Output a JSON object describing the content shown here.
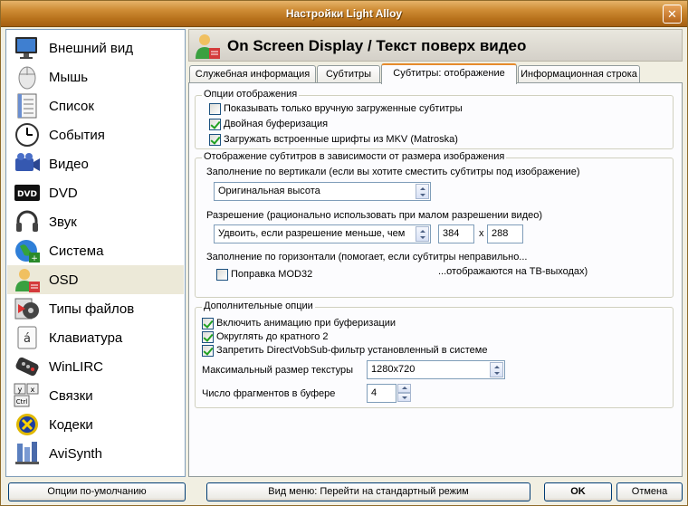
{
  "window": {
    "title": "Настройки Light Alloy",
    "close_glyph": "✕"
  },
  "sidebar": {
    "items": [
      {
        "label": "Внешний вид",
        "icon": "monitor-icon"
      },
      {
        "label": "Мышь",
        "icon": "mouse-icon"
      },
      {
        "label": "Список",
        "icon": "list-icon"
      },
      {
        "label": "События",
        "icon": "clock-icon"
      },
      {
        "label": "Видео",
        "icon": "video-camera-icon"
      },
      {
        "label": "DVD",
        "icon": "dvd-icon"
      },
      {
        "label": "Звук",
        "icon": "headphones-icon"
      },
      {
        "label": "Система",
        "icon": "globe-icon"
      },
      {
        "label": "OSD",
        "icon": "osd-user-icon",
        "selected": true
      },
      {
        "label": "Типы файлов",
        "icon": "file-types-icon"
      },
      {
        "label": "Клавиатура",
        "icon": "keyboard-icon"
      },
      {
        "label": "WinLIRC",
        "icon": "remote-control-icon"
      },
      {
        "label": "Связки",
        "icon": "hotkeys-icon"
      },
      {
        "label": "Кодеки",
        "icon": "codecs-icon"
      },
      {
        "label": "AviSynth",
        "icon": "avisynth-icon"
      }
    ]
  },
  "header": {
    "title": "On Screen Display / Текст поверх видео"
  },
  "tabs": [
    {
      "label": "Служебная информация"
    },
    {
      "label": "Субтитры"
    },
    {
      "label": "Субтитры: отображение",
      "active": true
    },
    {
      "label": "Информационная строка"
    }
  ],
  "display_options": {
    "title": "Опции отображения",
    "show_manual_only": {
      "label": "Показывать только вручную загруженные субтитры",
      "checked": false
    },
    "double_buffer": {
      "label": "Двойная буферизация",
      "checked": true
    },
    "load_mkv_fonts": {
      "label": "Загружать встроенные шрифты из MKV (Matroska)",
      "checked": true
    }
  },
  "size_dependent": {
    "title": "Отображение субтитров в зависимости от размера изображения",
    "vertical_label": "Заполнение по вертикали (если вы хотите сместить субтитры под изображение)",
    "vertical_value": "Оригинальная высота",
    "resolution_label": "Разрешение (рационально использовать при малом разрешении видео)",
    "resolution_value": "Удвоить, если разрешение меньше, чем",
    "res_width": "384",
    "res_x": "x",
    "res_height": "288",
    "horizontal_label_1": "Заполнение по горизонтали (помогает, если субтитры неправильно...",
    "horizontal_label_2": "...отображаются на ТВ-выходах)",
    "mod32": {
      "label": "Поправка MOD32",
      "checked": false
    }
  },
  "additional": {
    "title": "Дополнительные опции",
    "animate_buffering": {
      "label": "Включить анимацию при буферизации",
      "checked": true
    },
    "round_to_2": {
      "label": "Округлять до кратного 2",
      "checked": true
    },
    "block_directvobsub": {
      "label": "Запретить DirectVobSub-фильтр установленный в системе",
      "checked": true
    },
    "max_texture_label": "Максимальный размер текстуры",
    "max_texture_value": "1280x720",
    "fragments_label": "Число фрагментов в буфере",
    "fragments_value": "4"
  },
  "footer": {
    "defaults_label": "Опции по-умолчанию",
    "menu_view_label": "Вид меню: Перейти на стандартный режим",
    "ok_label": "OK",
    "cancel_label": "Отмена"
  },
  "colors": {
    "title_bar": "#c17b24",
    "tab_accent": "#e68b2c",
    "checkmark": "#21a121"
  }
}
